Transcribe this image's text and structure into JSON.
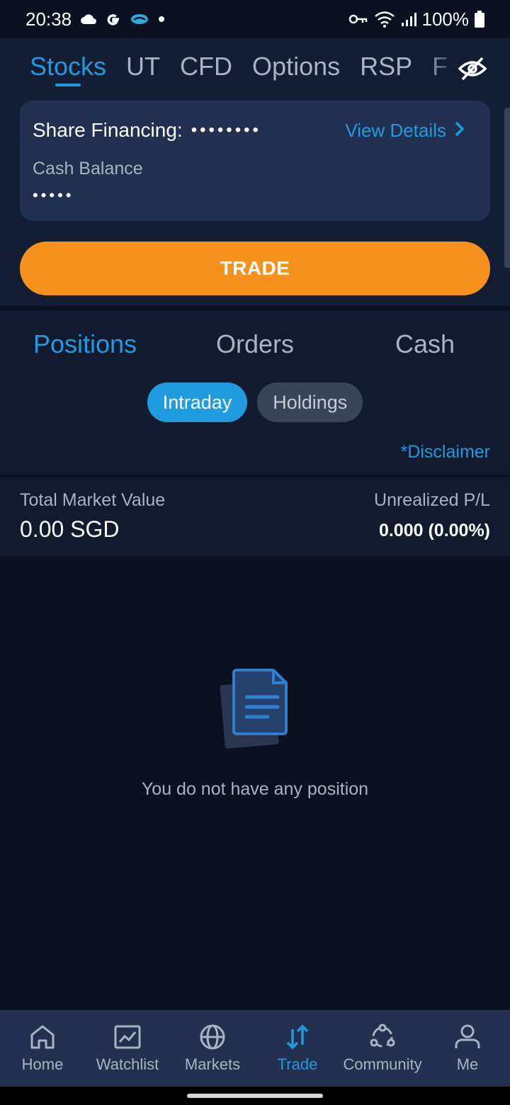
{
  "status_bar": {
    "time": "20:38",
    "battery": "100%",
    "icons_left": [
      "cloud-icon",
      "google-icon",
      "app-icon",
      "dot-icon"
    ],
    "icons_right": [
      "vpn-key-icon",
      "wifi-icon",
      "signal-icon",
      "battery-icon"
    ]
  },
  "market_tabs": {
    "items": [
      {
        "label": "Stocks",
        "active": true
      },
      {
        "label": "UT",
        "active": false
      },
      {
        "label": "CFD",
        "active": false
      },
      {
        "label": "Options",
        "active": false
      },
      {
        "label": "RSP",
        "active": false
      },
      {
        "label": "F",
        "active": false
      }
    ],
    "visibility_icon": "eye-off-icon"
  },
  "account_card": {
    "share_financing_label": "Share Financing:",
    "share_financing_value": "••••••••",
    "view_details_label": "View Details",
    "cash_balance_label": "Cash Balance",
    "cash_balance_value": "•••••"
  },
  "trade_button": {
    "label": "TRADE"
  },
  "section_tabs": {
    "items": [
      {
        "label": "Positions",
        "active": true
      },
      {
        "label": "Orders",
        "active": false
      },
      {
        "label": "Cash",
        "active": false
      }
    ]
  },
  "filter_pills": {
    "intraday": "Intraday",
    "holdings": "Holdings",
    "selected": "Intraday"
  },
  "disclaimer": "*Disclaimer",
  "summary": {
    "total_market_value_label": "Total Market Value",
    "total_market_value": "0.00 SGD",
    "unrealized_pl_label": "Unrealized P/L",
    "unrealized_pl": "0.000 (0.00%)"
  },
  "empty_state": {
    "message": "You do not have any position",
    "icon": "document-icon"
  },
  "bottom_nav": {
    "items": [
      {
        "label": "Home",
        "icon": "home-icon",
        "active": false
      },
      {
        "label": "Watchlist",
        "icon": "chart-icon",
        "active": false
      },
      {
        "label": "Markets",
        "icon": "globe-icon",
        "active": false
      },
      {
        "label": "Trade",
        "icon": "trade-arrows-icon",
        "active": true
      },
      {
        "label": "Community",
        "icon": "community-icon",
        "active": false
      },
      {
        "label": "Me",
        "icon": "user-icon",
        "active": false
      }
    ]
  },
  "colors": {
    "accent": "#1f9be0",
    "trade_button": "#f6911e",
    "background": "#0b1120",
    "card": "#213050"
  }
}
